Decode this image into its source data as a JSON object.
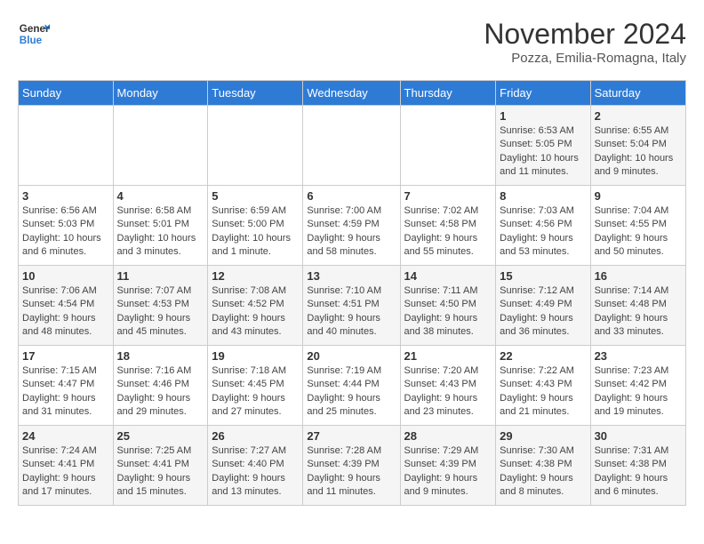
{
  "logo": {
    "line1": "General",
    "line2": "Blue"
  },
  "title": "November 2024",
  "subtitle": "Pozza, Emilia-Romagna, Italy",
  "days_of_week": [
    "Sunday",
    "Monday",
    "Tuesday",
    "Wednesday",
    "Thursday",
    "Friday",
    "Saturday"
  ],
  "weeks": [
    [
      {
        "day": "",
        "info": ""
      },
      {
        "day": "",
        "info": ""
      },
      {
        "day": "",
        "info": ""
      },
      {
        "day": "",
        "info": ""
      },
      {
        "day": "",
        "info": ""
      },
      {
        "day": "1",
        "info": "Sunrise: 6:53 AM\nSunset: 5:05 PM\nDaylight: 10 hours and 11 minutes."
      },
      {
        "day": "2",
        "info": "Sunrise: 6:55 AM\nSunset: 5:04 PM\nDaylight: 10 hours and 9 minutes."
      }
    ],
    [
      {
        "day": "3",
        "info": "Sunrise: 6:56 AM\nSunset: 5:03 PM\nDaylight: 10 hours and 6 minutes."
      },
      {
        "day": "4",
        "info": "Sunrise: 6:58 AM\nSunset: 5:01 PM\nDaylight: 10 hours and 3 minutes."
      },
      {
        "day": "5",
        "info": "Sunrise: 6:59 AM\nSunset: 5:00 PM\nDaylight: 10 hours and 1 minute."
      },
      {
        "day": "6",
        "info": "Sunrise: 7:00 AM\nSunset: 4:59 PM\nDaylight: 9 hours and 58 minutes."
      },
      {
        "day": "7",
        "info": "Sunrise: 7:02 AM\nSunset: 4:58 PM\nDaylight: 9 hours and 55 minutes."
      },
      {
        "day": "8",
        "info": "Sunrise: 7:03 AM\nSunset: 4:56 PM\nDaylight: 9 hours and 53 minutes."
      },
      {
        "day": "9",
        "info": "Sunrise: 7:04 AM\nSunset: 4:55 PM\nDaylight: 9 hours and 50 minutes."
      }
    ],
    [
      {
        "day": "10",
        "info": "Sunrise: 7:06 AM\nSunset: 4:54 PM\nDaylight: 9 hours and 48 minutes."
      },
      {
        "day": "11",
        "info": "Sunrise: 7:07 AM\nSunset: 4:53 PM\nDaylight: 9 hours and 45 minutes."
      },
      {
        "day": "12",
        "info": "Sunrise: 7:08 AM\nSunset: 4:52 PM\nDaylight: 9 hours and 43 minutes."
      },
      {
        "day": "13",
        "info": "Sunrise: 7:10 AM\nSunset: 4:51 PM\nDaylight: 9 hours and 40 minutes."
      },
      {
        "day": "14",
        "info": "Sunrise: 7:11 AM\nSunset: 4:50 PM\nDaylight: 9 hours and 38 minutes."
      },
      {
        "day": "15",
        "info": "Sunrise: 7:12 AM\nSunset: 4:49 PM\nDaylight: 9 hours and 36 minutes."
      },
      {
        "day": "16",
        "info": "Sunrise: 7:14 AM\nSunset: 4:48 PM\nDaylight: 9 hours and 33 minutes."
      }
    ],
    [
      {
        "day": "17",
        "info": "Sunrise: 7:15 AM\nSunset: 4:47 PM\nDaylight: 9 hours and 31 minutes."
      },
      {
        "day": "18",
        "info": "Sunrise: 7:16 AM\nSunset: 4:46 PM\nDaylight: 9 hours and 29 minutes."
      },
      {
        "day": "19",
        "info": "Sunrise: 7:18 AM\nSunset: 4:45 PM\nDaylight: 9 hours and 27 minutes."
      },
      {
        "day": "20",
        "info": "Sunrise: 7:19 AM\nSunset: 4:44 PM\nDaylight: 9 hours and 25 minutes."
      },
      {
        "day": "21",
        "info": "Sunrise: 7:20 AM\nSunset: 4:43 PM\nDaylight: 9 hours and 23 minutes."
      },
      {
        "day": "22",
        "info": "Sunrise: 7:22 AM\nSunset: 4:43 PM\nDaylight: 9 hours and 21 minutes."
      },
      {
        "day": "23",
        "info": "Sunrise: 7:23 AM\nSunset: 4:42 PM\nDaylight: 9 hours and 19 minutes."
      }
    ],
    [
      {
        "day": "24",
        "info": "Sunrise: 7:24 AM\nSunset: 4:41 PM\nDaylight: 9 hours and 17 minutes."
      },
      {
        "day": "25",
        "info": "Sunrise: 7:25 AM\nSunset: 4:41 PM\nDaylight: 9 hours and 15 minutes."
      },
      {
        "day": "26",
        "info": "Sunrise: 7:27 AM\nSunset: 4:40 PM\nDaylight: 9 hours and 13 minutes."
      },
      {
        "day": "27",
        "info": "Sunrise: 7:28 AM\nSunset: 4:39 PM\nDaylight: 9 hours and 11 minutes."
      },
      {
        "day": "28",
        "info": "Sunrise: 7:29 AM\nSunset: 4:39 PM\nDaylight: 9 hours and 9 minutes."
      },
      {
        "day": "29",
        "info": "Sunrise: 7:30 AM\nSunset: 4:38 PM\nDaylight: 9 hours and 8 minutes."
      },
      {
        "day": "30",
        "info": "Sunrise: 7:31 AM\nSunset: 4:38 PM\nDaylight: 9 hours and 6 minutes."
      }
    ]
  ]
}
